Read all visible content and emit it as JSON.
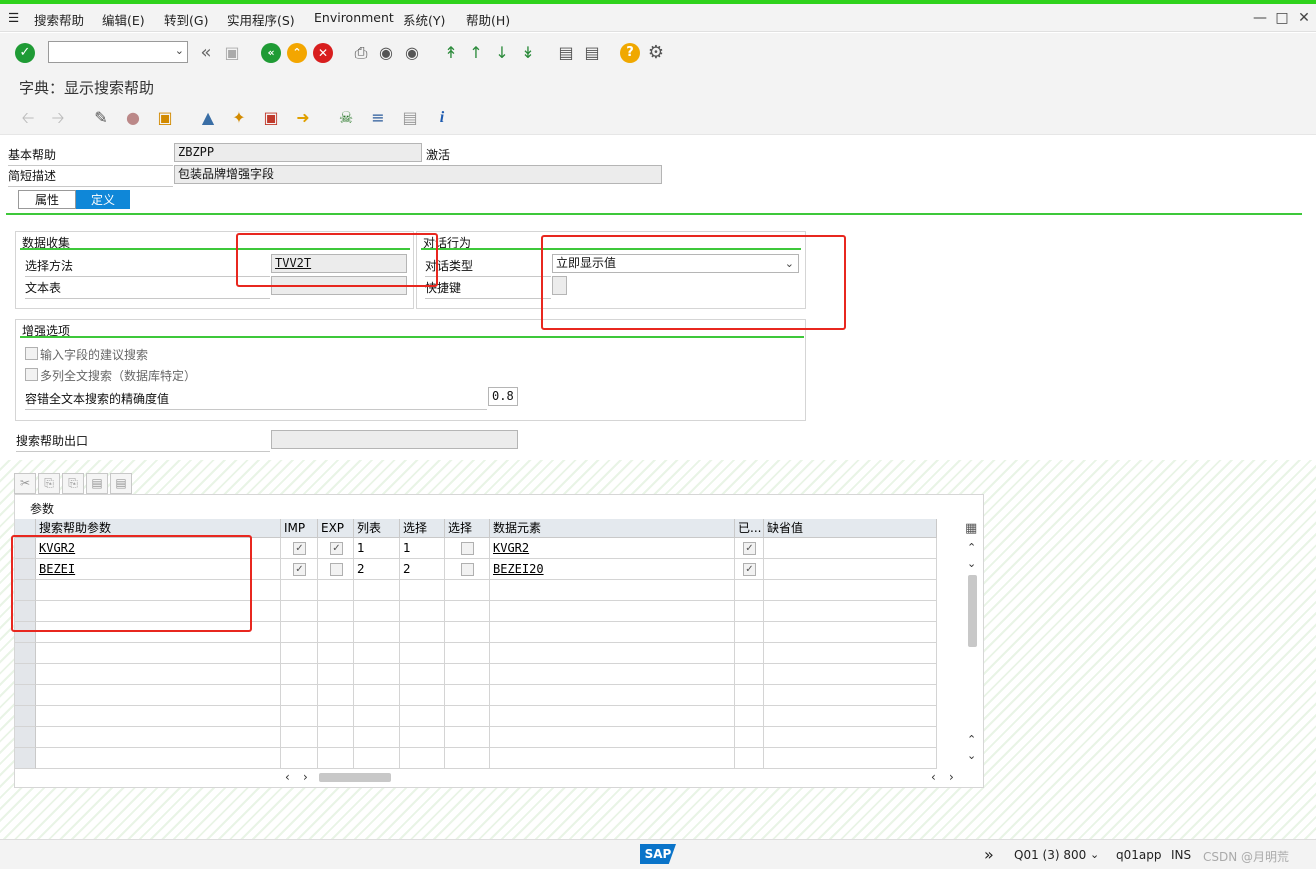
{
  "menu": {
    "items": [
      "搜索帮助",
      "编辑(E)",
      "转到(G)",
      "实用程序(S)",
      "Environment",
      "系统(Y)",
      "帮助(H)"
    ]
  },
  "window": {
    "title": "字典：显示搜索帮助"
  },
  "header": {
    "basic_help_label": "基本帮助",
    "basic_help_value": "ZBZPP",
    "status": "激活",
    "short_desc_label": "简短描述",
    "short_desc_value": "包装品牌增强字段"
  },
  "tabs": [
    {
      "label": "属性",
      "active": false
    },
    {
      "label": "定义",
      "active": true
    }
  ],
  "data_collection": {
    "title": "数据收集",
    "selection_method_label": "选择方法",
    "selection_method_value": "TVV2T",
    "text_table_label": "文本表",
    "text_table_value": ""
  },
  "dialog_behavior": {
    "title": "对话行为",
    "dialog_type_label": "对话类型",
    "dialog_type_value": "立即显示值",
    "hotkey_label": "快捷键",
    "hotkey_value": ""
  },
  "enhanced_options": {
    "title": "增强选项",
    "proposal_search_label": "输入字段的建议搜索",
    "multi_column_label": "多列全文搜索（数据库特定）",
    "fuzzy_label": "容错全文本搜索的精确度值",
    "fuzzy_value": "0.8"
  },
  "exit": {
    "label": "搜索帮助出口",
    "value": ""
  },
  "params": {
    "title": "参数",
    "columns": [
      "搜索帮助参数",
      "IMP",
      "EXP",
      "列表",
      "选择",
      "选择",
      "数据元素",
      "已...",
      "缺省值"
    ],
    "rows": [
      {
        "param": "KVGR2",
        "imp": true,
        "exp": true,
        "lpos": "1",
        "spos": "1",
        "sdis": false,
        "element": "KVGR2",
        "mod": true,
        "default": ""
      },
      {
        "param": "BEZEI",
        "imp": true,
        "exp": false,
        "lpos": "2",
        "spos": "2",
        "sdis": false,
        "element": "BEZEI20",
        "mod": true,
        "default": ""
      }
    ]
  },
  "status_bar": {
    "system": "Q01 (3) 800",
    "server": "q01app",
    "mode": "INS",
    "watermark": "CSDN @月明荒"
  },
  "colors": {
    "accent_green": "#2fd21c",
    "tab_active": "#0f87d8",
    "highlight_red": "#e8271f"
  },
  "icons": [
    "check-icon",
    "back-icon",
    "save-icon",
    "nav-back-icon",
    "nav-exit-icon",
    "cancel-icon",
    "print-icon",
    "find-icon",
    "find-next-icon",
    "first-page-icon",
    "prev-page-icon",
    "next-page-icon",
    "last-page-icon",
    "new-session-icon",
    "shortcut-icon",
    "help-icon",
    "settings-icon",
    "sap-logo"
  ]
}
